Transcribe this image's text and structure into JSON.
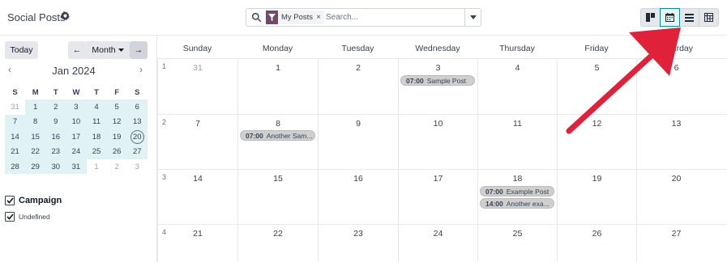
{
  "app": {
    "title": "Social Posts"
  },
  "search": {
    "facet_label": "My Posts",
    "placeholder": "Search..."
  },
  "toolbar": {
    "today": "Today",
    "prev": "←",
    "next": "→",
    "scale": "Month"
  },
  "mini_calendar": {
    "title": "Jan 2024",
    "prev": "‹",
    "next": "›",
    "weekdays": [
      "S",
      "M",
      "T",
      "W",
      "T",
      "F",
      "S"
    ],
    "weeks": [
      [
        "31",
        "1",
        "2",
        "3",
        "4",
        "5",
        "6"
      ],
      [
        "7",
        "8",
        "9",
        "10",
        "11",
        "12",
        "13"
      ],
      [
        "14",
        "15",
        "16",
        "17",
        "18",
        "19",
        "20"
      ],
      [
        "21",
        "22",
        "23",
        "24",
        "25",
        "26",
        "27"
      ],
      [
        "28",
        "29",
        "30",
        "31",
        "1",
        "2",
        "3"
      ]
    ]
  },
  "filters": {
    "group": "Campaign",
    "items": [
      "Undefined"
    ]
  },
  "calendar": {
    "days": [
      "Sunday",
      "Monday",
      "Tuesday",
      "Wednesday",
      "Thursday",
      "Friday",
      "Saturday"
    ],
    "weeks": [
      {
        "num": "1",
        "dates": [
          "31",
          "1",
          "2",
          "3",
          "4",
          "5",
          "6"
        ]
      },
      {
        "num": "2",
        "dates": [
          "7",
          "8",
          "9",
          "10",
          "11",
          "12",
          "13"
        ]
      },
      {
        "num": "3",
        "dates": [
          "14",
          "15",
          "16",
          "17",
          "18",
          "19",
          "20"
        ]
      },
      {
        "num": "4",
        "dates": [
          "21",
          "22",
          "23",
          "24",
          "25",
          "26",
          "27"
        ]
      }
    ],
    "events": [
      {
        "time": "07:00",
        "title": "Sample Post"
      },
      {
        "time": "07:00",
        "title": "Another Sam..."
      },
      {
        "time": "07:00",
        "title": "Example Post"
      },
      {
        "time": "14:00",
        "title": "Another exa..."
      }
    ]
  },
  "colors": {
    "accent": "#714b67",
    "active_view": "#0f8c8c",
    "today_highlight": "#e0f2f3",
    "annotation_arrow": "#e0213a"
  }
}
